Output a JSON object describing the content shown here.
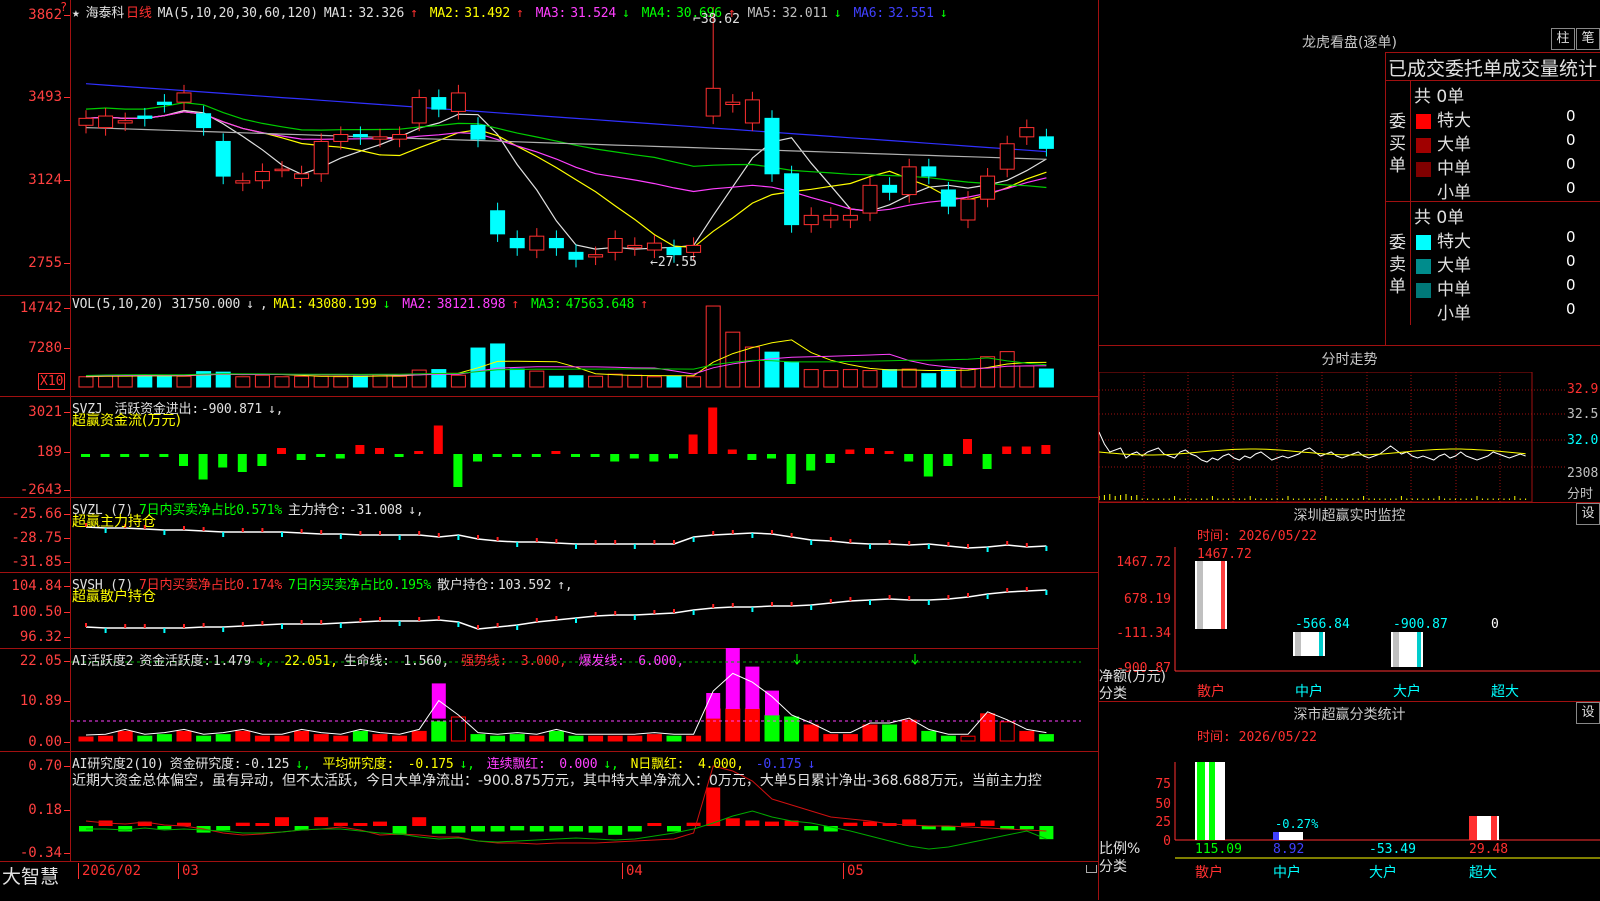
{
  "main": {
    "star": "★",
    "name": "海泰科",
    "period": "日线",
    "ma_label": "MA(5,10,20,30,60,120)",
    "ma": [
      {
        "label": "MA1:",
        "value": "32.326",
        "arrow": "↑",
        "color": "#e0e0e0"
      },
      {
        "label": "MA2:",
        "value": "31.492",
        "arrow": "↑",
        "color": "#ffff00"
      },
      {
        "label": "MA3:",
        "value": "31.524",
        "arrow": "↓",
        "color": "#ff40ff"
      },
      {
        "label": "MA4:",
        "value": "30.696",
        "arrow": "↑",
        "color": "#00ff00"
      },
      {
        "label": "MA5:",
        "value": "32.011",
        "arrow": "↓",
        "color": "#c0c0c0"
      },
      {
        "label": "MA6:",
        "value": "32.551",
        "arrow": "↓",
        "color": "#4040ff"
      }
    ],
    "high_label": "38.62",
    "low_label": "←27.55",
    "axis_ticks": [
      "3862",
      "3493",
      "3124",
      "2755"
    ]
  },
  "vol": {
    "label": "VOL(5,10,20)",
    "value": "31750.000",
    "arrow": "↓",
    "ma": [
      {
        "label": "MA1:",
        "value": "43080.199",
        "arrow": "↓",
        "color": "#ffff00"
      },
      {
        "label": "MA2:",
        "value": "38121.898",
        "arrow": "↑",
        "color": "#ff40ff"
      },
      {
        "label": "MA3:",
        "value": "47563.648",
        "arrow": "↑",
        "color": "#00ff00"
      }
    ],
    "axis_ticks": [
      "14742",
      "7280"
    ],
    "unit": "X10"
  },
  "svzj": {
    "name": "SVZJ",
    "l1": "活跃资金进出:",
    "v1": "-900.871",
    "a1": "↓,",
    "sub": "超赢资金流(万元)",
    "axis_ticks": [
      "3021",
      "189",
      "-2643"
    ]
  },
  "svzl": {
    "name": "SVZL (7)",
    "l1": "7日内买卖净占比0.571%",
    "l2": "主力持仓:",
    "v2": "-31.008",
    "a2": "↓,",
    "sub": "超赢主力持仓",
    "axis_ticks": [
      "-25.66",
      "-28.75",
      "-31.85"
    ]
  },
  "svsh": {
    "name": "SVSH (7)",
    "l1": "7日内买卖净占比0.174%",
    "l2": "7日内买卖净占比0.195%",
    "l3": "散户持仓:",
    "v3": "103.592",
    "a3": "↑,",
    "sub": "超赢散户持仓",
    "axis_ticks": [
      "104.84",
      "100.50",
      "96.32"
    ]
  },
  "ai1": {
    "name": "AI活跃度2",
    "l1": "资金活跃度:",
    "v1": "1.479",
    "a1": "↓,",
    "v2": "22.051,",
    "l3": "生命线:",
    "v3": "1.560,",
    "l4": "强势线:",
    "v4": "3.000,",
    "l5": "爆发线:",
    "v5": "6.000,",
    "axis_ticks": [
      "22.05",
      "10.89",
      "0.00"
    ]
  },
  "ai2": {
    "name": "AI研究度2(10)",
    "l1": "资金研究度:",
    "v1": "-0.125",
    "a1": "↓,",
    "l2": "平均研究度:",
    "v2": "-0.175",
    "a2": "↓,",
    "l3": "连续飘红:",
    "v3": "0.000",
    "a3": "↓,",
    "l4": "N日飘红:",
    "v4": "4.000,",
    "v5": "-0.175",
    "a5": "↓",
    "text": "近期大资金总体偏空，虽有异动，但不太活跃，今日大单净流出：-900.875万元，其中特大单净流入：0万元，大单5日累计净出-368.688万元，当前主力控",
    "axis_ticks": [
      "0.70",
      "0.18",
      "-0.34"
    ]
  },
  "bottom": {
    "brand": "大智慧",
    "dates": [
      "2026/02",
      "03",
      "04",
      "05"
    ]
  },
  "dragon": {
    "title": "龙虎看盘(逐单)",
    "btn1": "柱",
    "btn2": "笔",
    "header": "已成交委托单成交量统计",
    "buy": {
      "side": "委买单",
      "total": "共 0单",
      "rows": [
        {
          "name": "特大",
          "count": "0",
          "pct": "0%",
          "color": "#ff0000"
        },
        {
          "name": "大单",
          "count": "0",
          "pct": "0%",
          "color": "#a00000"
        },
        {
          "name": "中单",
          "count": "0",
          "pct": "0%",
          "color": "#800000"
        },
        {
          "name": "小单",
          "count": "0",
          "pct": "0%",
          "color": "#000000"
        }
      ]
    },
    "sell": {
      "side": "委卖单",
      "total": "共 0单",
      "rows": [
        {
          "name": "特大",
          "count": "0",
          "pct": "0%",
          "color": "#00ffff"
        },
        {
          "name": "大单",
          "count": "0",
          "pct": "0%",
          "color": "#008c8c"
        },
        {
          "name": "中单",
          "count": "0",
          "pct": "0%",
          "color": "#007878"
        },
        {
          "name": "小单",
          "count": "0",
          "pct": "0%",
          "color": "#000000"
        }
      ]
    }
  },
  "intraday": {
    "title": "分时走势",
    "ticks": [
      "32.9",
      "32.5",
      "32.0",
      "2308"
    ],
    "unit": "分时"
  },
  "sz_monitor": {
    "title": "深圳超赢实时监控",
    "btn": "设",
    "time": "时间: 2026/05/22",
    "axis_ticks": [
      "1467.72",
      "678.19",
      "-111.34",
      "-900.87"
    ],
    "ylabel1": "净额(万元)",
    "ylabel2": "分类",
    "categories": [
      "散户",
      "中户",
      "大户",
      "超大"
    ],
    "bar_values": [
      "1467.72",
      "-566.84",
      "-900.87",
      "0"
    ]
  },
  "sz_class": {
    "title": "深市超赢分类统计",
    "btn": "设",
    "time": "时间: 2026/05/22",
    "axis_ticks": [
      "75",
      "50",
      "25",
      "0"
    ],
    "pct_label": "-0.27%",
    "ylabel1": "比例%",
    "ylabel2": "分类",
    "categories": [
      "散户",
      "中户",
      "大户",
      "超大"
    ],
    "bar_values": [
      "115.09",
      "8.92",
      "-53.49",
      "29.48"
    ]
  },
  "colors": {
    "up": "#ff3030",
    "down": "#00ffff",
    "grid": "#a01010"
  }
}
